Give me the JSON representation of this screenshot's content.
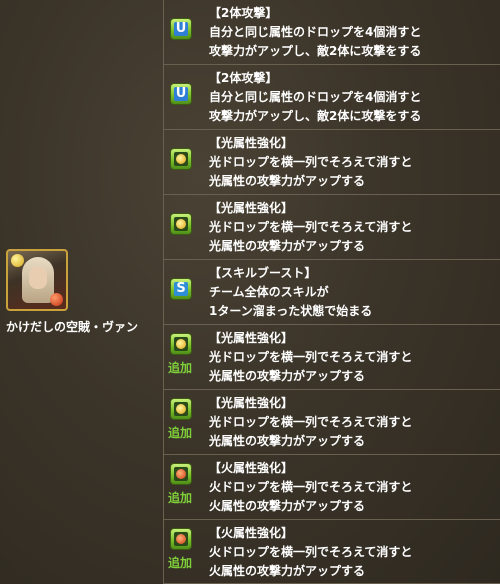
{
  "monster": {
    "name": "かけだしの空賊・ヴァン",
    "icon": "monster-portrait-van"
  },
  "awakenings": [
    {
      "icon": "two-pronged-attack-icon",
      "glyph": "U",
      "type": "blue",
      "added": false,
      "added_label": "",
      "lines": [
        "【2体攻撃】",
        "自分と同じ属性のドロップを4個消すと",
        "攻撃力がアップし、敵2体に攻撃をする"
      ]
    },
    {
      "icon": "two-pronged-attack-icon",
      "glyph": "U",
      "type": "blue",
      "added": false,
      "added_label": "",
      "lines": [
        "【2体攻撃】",
        "自分と同じ属性のドロップを4個消すと",
        "攻撃力がアップし、敵2体に攻撃をする"
      ]
    },
    {
      "icon": "enhanced-light-row-icon",
      "glyph": "",
      "type": "light",
      "added": false,
      "added_label": "",
      "lines": [
        "【光属性強化】",
        "光ドロップを横一列でそろえて消すと",
        "光属性の攻撃力がアップする"
      ]
    },
    {
      "icon": "enhanced-light-row-icon",
      "glyph": "",
      "type": "light",
      "added": false,
      "added_label": "",
      "lines": [
        "【光属性強化】",
        "光ドロップを横一列でそろえて消すと",
        "光属性の攻撃力がアップする"
      ]
    },
    {
      "icon": "skill-boost-icon",
      "glyph": "S",
      "type": "skill",
      "added": false,
      "added_label": "",
      "lines": [
        "【スキルブースト】",
        "チーム全体のスキルが",
        "1ターン溜まった状態で始まる"
      ]
    },
    {
      "icon": "enhanced-light-row-icon",
      "glyph": "",
      "type": "light",
      "added": true,
      "added_label": "追加",
      "lines": [
        "【光属性強化】",
        "光ドロップを横一列でそろえて消すと",
        "光属性の攻撃力がアップする"
      ]
    },
    {
      "icon": "enhanced-light-row-icon",
      "glyph": "",
      "type": "light",
      "added": true,
      "added_label": "追加",
      "lines": [
        "【光属性強化】",
        "光ドロップを横一列でそろえて消すと",
        "光属性の攻撃力がアップする"
      ]
    },
    {
      "icon": "enhanced-fire-row-icon",
      "glyph": "",
      "type": "fire",
      "added": true,
      "added_label": "追加",
      "lines": [
        "【火属性強化】",
        "火ドロップを横一列でそろえて消すと",
        "火属性の攻撃力がアップする"
      ]
    },
    {
      "icon": "enhanced-fire-row-icon",
      "glyph": "",
      "type": "fire",
      "added": true,
      "added_label": "追加",
      "lines": [
        "【火属性強化】",
        "火ドロップを横一列でそろえて消すと",
        "火属性の攻撃力がアップする"
      ]
    }
  ]
}
